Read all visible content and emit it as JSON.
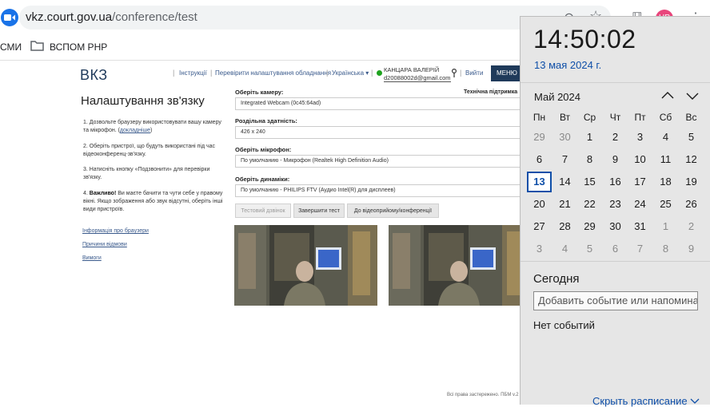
{
  "browser": {
    "url_host": "vkz.court.gov.ua",
    "url_path": "/conference/test",
    "profile_initials": "HP",
    "bookmarks": [
      "СМИ",
      "ВСПОМ PHP"
    ]
  },
  "site": {
    "logo": "ВКЗ",
    "nav": [
      "Інструкції",
      "Перевірити налаштування обладнання",
      "Українська ▾"
    ],
    "user_name": "КАНЦАРА ВАЛЕРІЙ",
    "user_email": "d20088002d@gmail.com",
    "logout": "Вийти",
    "menu": "МЕНЮ",
    "page_title": "Налаштування зв'язку",
    "support": "Технічна підтримка",
    "steps": [
      {
        "n": "1.",
        "text": "Дозвольте браузеру використовувати вашу камеру та мікрофон. (",
        "link": "докладніше",
        "tail": ")"
      },
      {
        "n": "2.",
        "text": "Оберіть пристрої, що будуть використані під час відеоконференц-зв'язку."
      },
      {
        "n": "3.",
        "text": "Натисніть кнопку «Подзвонити» для перевірки зв'язку."
      },
      {
        "n": "4.",
        "bold": "Важливо!",
        "text": " Ви маєте бачити та чути себе у правому вікні. Якщо зображення або звук відсутні, оберіть інші види пристроїв."
      }
    ],
    "side_links": [
      "Інформація про браузери",
      "Причини відмови",
      "Вимоги"
    ],
    "camera_label": "Оберіть камеру:",
    "camera_value": "Integrated Webcam (0c45:64ad)",
    "resolution_label": "Роздільна здатність:",
    "resolution_value": "426 x 240",
    "mic_label": "Оберіть мікрофон:",
    "mic_value": "По умолчанию - Микрофон (Realtek High Definition Audio)",
    "speaker_label": "Оберіть динаміки:",
    "speaker_value": "По умолчанию - PHILIPS FTV (Аудио Intel(R) для дисплеев)",
    "btn_test_call": "Тестовий дзвінок",
    "btn_finish": "Завершити тест",
    "btn_conference": "До відеоприйому/конференції",
    "footer": "Всі права застережено. ПБМ v.2"
  },
  "calendar": {
    "time": "14:50:02",
    "date": "13 мая 2024 г.",
    "month": "Май 2024",
    "weekdays": [
      "Пн",
      "Вт",
      "Ср",
      "Чт",
      "Пт",
      "Сб",
      "Вс"
    ],
    "days": [
      [
        "29",
        "30",
        "1",
        "2",
        "3",
        "4",
        "5"
      ],
      [
        "6",
        "7",
        "8",
        "9",
        "10",
        "11",
        "12"
      ],
      [
        "13",
        "14",
        "15",
        "16",
        "17",
        "18",
        "19"
      ],
      [
        "20",
        "21",
        "22",
        "23",
        "24",
        "25",
        "26"
      ],
      [
        "27",
        "28",
        "29",
        "30",
        "31",
        "1",
        "2"
      ],
      [
        "3",
        "4",
        "5",
        "6",
        "7",
        "8",
        "9"
      ]
    ],
    "today_title": "Сегодня",
    "event_placeholder": "Добавить событие или напоминание",
    "no_events": "Нет событий",
    "hide_schedule": "Скрыть расписание"
  }
}
